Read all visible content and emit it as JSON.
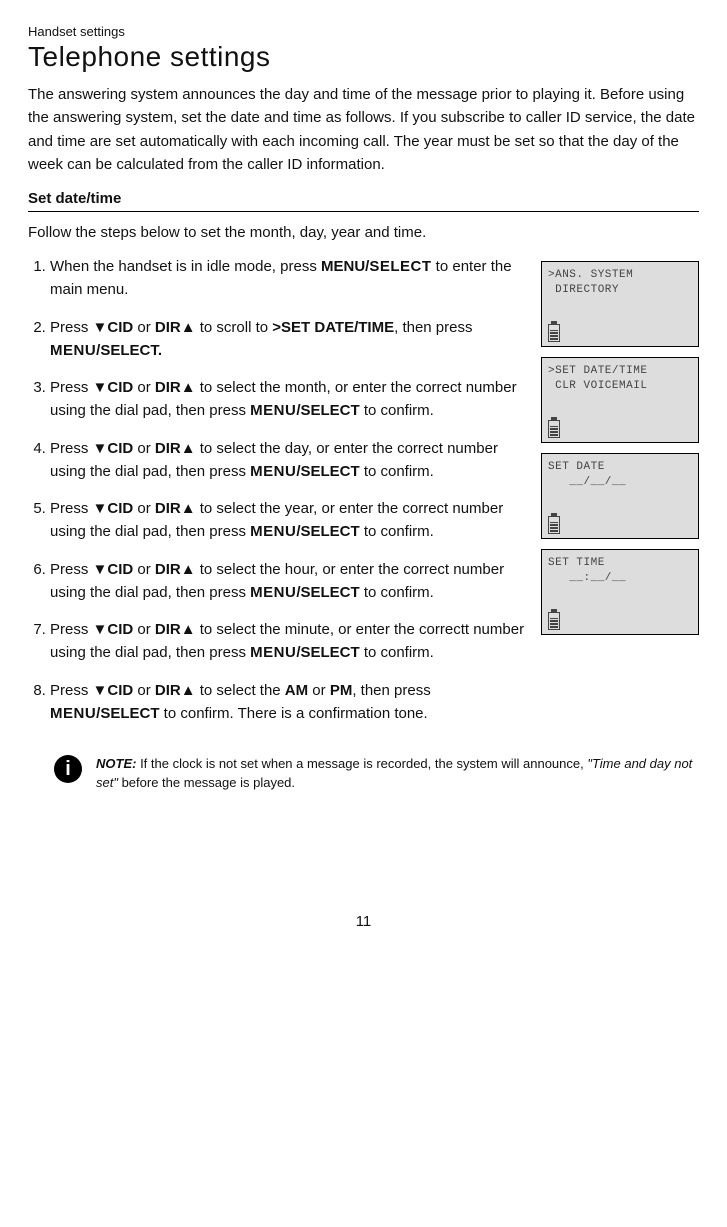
{
  "header": {
    "section": "Handset settings",
    "title": "Telephone settings"
  },
  "intro": "The answering system announces the day and time of the message prior to playing it. Before using the answering system, set the date and time as follows. If you subscribe to caller ID service, the date and time are set automatically with each incoming call. The year must be set so that the day of the week can be calculated from the caller ID information.",
  "subheading": "Set date/time",
  "follow": "Follow the steps below to set the month, day, year and time.",
  "steps": [
    {
      "pre": "When the handset is in idle mode, press ",
      "b1": "MENU/",
      "sc": "SELECT",
      "post": " to enter the main menu."
    },
    {
      "pre": "Press ▼",
      "b1": "CID",
      "mid": " or ",
      "b2": "DIR",
      "post2": "▲ to scroll to ",
      "b3": ">SET DATE/TIME",
      "post3": ", then press ",
      "sc2": "MENU",
      "b4": "/SELECT."
    },
    {
      "pre": "Press ▼",
      "b1": "CID",
      "mid": " or ",
      "b2": "DIR",
      "post2": "▲ to select the month, or enter the correct number using the dial pad, then press ",
      "sc2": "MENU",
      "b4": "/SELECT",
      "post4": " to confirm."
    },
    {
      "pre": "Press ▼",
      "b1": "CID",
      "mid": " or ",
      "b2": "DIR",
      "post2": "▲ to select the day, or enter the correct number using the dial pad, then press ",
      "sc2": "MENU",
      "b4": "/SELECT",
      "post4": " to confirm."
    },
    {
      "pre": "Press ▼",
      "b1": "CID",
      "mid": " or ",
      "b2": "DIR",
      "post2": "▲ to select the year, or enter the correct number using the dial pad, then press ",
      "sc2": "MENU",
      "b4": "/SELECT",
      "post4": " to confirm."
    },
    {
      "pre": "Press ▼",
      "b1": "CID",
      "mid": " or ",
      "b2": "DIR",
      "post2": "▲ to select the hour, or enter the correct number using the dial pad, then press ",
      "sc2": "MENU",
      "b4": "/SELECT",
      "post4": " to confirm."
    },
    {
      "pre": "Press ▼",
      "b1": "CID",
      "mid": " or ",
      "b2": "DIR",
      "post2": "▲ to select the minute, or enter the correctt number using the dial pad, then press ",
      "sc2": "MENU",
      "b4": "/SELECT",
      "post4": " to confirm."
    },
    {
      "pre": "Press ▼",
      "b1": "CID",
      "mid": " or ",
      "b2": "DIR",
      "post2": "▲ to select the ",
      "b3": "AM",
      "mid3": " or ",
      "b3b": "PM",
      "post3": ", then press ",
      "sc2": "MENU",
      "b4": "/SELECT",
      "post4": " to confirm. There is a confirmation tone."
    }
  ],
  "lcds": [
    {
      "l1": ">ANS. SYSTEM",
      "l2": " DIRECTORY"
    },
    {
      "l1": ">SET DATE/TIME",
      "l2": " CLR VOICEMAIL"
    },
    {
      "l1": "SET DATE",
      "l2": "   __/__/__"
    },
    {
      "l1": "SET TIME",
      "l2": "   __:__/__"
    }
  ],
  "note": {
    "label": "NOTE:",
    "text1": " If the clock is not set when a message is recorded, the system will announce, ",
    "italic": "\"Time and day not set\"",
    "text2": " before the message is played."
  },
  "page_number": "11"
}
